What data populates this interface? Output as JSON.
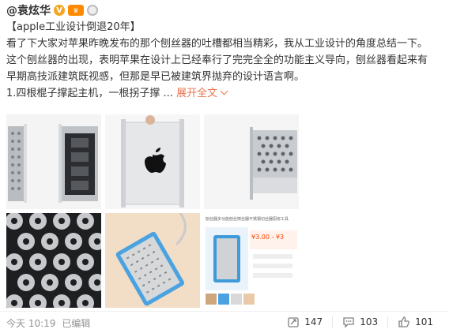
{
  "user": {
    "name": "@袁炫华",
    "vip_label": "V",
    "crown_label": "♛"
  },
  "post": {
    "title_line": "【apple工业设计倒退20年】",
    "lines": [
      "看了下大家对苹果昨晚发布的那个刨丝器的吐槽都相当精彩，我从工业设计的角度总结一下。",
      "这个刨丝器的出现，表明苹果在设计上已经奉行了完完全全的功能主义导向，刨丝器看起来有",
      "早期高技派建筑既视感，但那是早已被建筑界抛弃的设计语言啊。"
    ],
    "last_line": "1.四根棍子撑起主机，一根拐子撑 ...",
    "expand_label": "展开全文"
  },
  "images": [
    {
      "icon": "mac-pro-side-photo"
    },
    {
      "icon": "mac-pro-front-photo"
    },
    {
      "icon": "mac-pro-grille-photo"
    },
    {
      "icon": "lattice-pattern-photo"
    },
    {
      "icon": "cheese-grater-photo"
    },
    {
      "icon": "shopping-screenshot-photo",
      "screenshot_title": "刨丝器多功能刨丝擦丝器不锈钢切丝器厨房工具",
      "price": "¥3.00 - ¥3"
    }
  ],
  "footer": {
    "time": "今天 10:19",
    "edited": "已编辑",
    "repost_count": "147",
    "comment_count": "103",
    "like_count": "101"
  },
  "colors": {
    "link": "#eb7350",
    "meta": "#939393",
    "vip": "#f5a623"
  }
}
